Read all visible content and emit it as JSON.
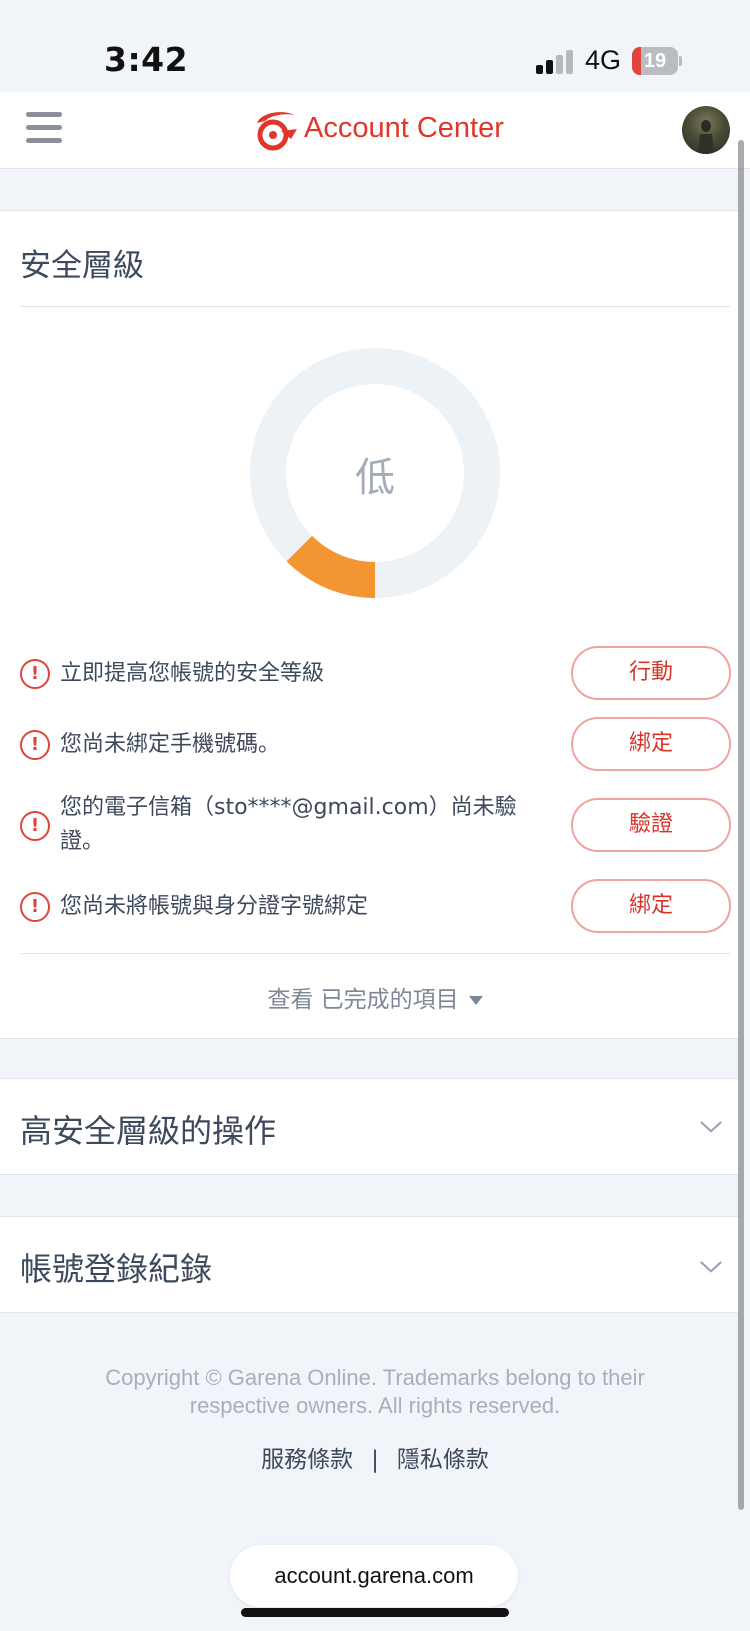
{
  "status_bar": {
    "time": "3:42",
    "network": "4G",
    "battery": "19",
    "battery_level": 0.19
  },
  "header": {
    "title": "Account Center",
    "menu_icon": "hamburger-menu-icon",
    "logo_icon": "garena-logo-icon",
    "avatar": "user-avatar"
  },
  "security": {
    "title": "安全層級",
    "level": "低",
    "level_fraction": 0.125,
    "colors": {
      "ring_bg": "#edf2f6",
      "progress": "#f39631",
      "alert": "#e0443a"
    },
    "tasks": [
      {
        "text": "立即提高您帳號的安全等級",
        "action": "行動"
      },
      {
        "text": "您尚未綁定手機號碼。",
        "action": "綁定"
      },
      {
        "text": "您的電子信箱（sto****@gmail.com）尚未驗證。",
        "action": "驗證"
      },
      {
        "text": "您尚未將帳號與身分證字號綁定",
        "action": "綁定"
      }
    ],
    "view_completed": "查看 已完成的項目"
  },
  "accordions": [
    {
      "title": "高安全層級的操作"
    },
    {
      "title": "帳號登錄紀錄"
    }
  ],
  "footer": {
    "copyright": "Copyright © Garena Online. Trademarks belong to their respective owners. All rights reserved.",
    "links": [
      "服務條款",
      "隱私條款"
    ],
    "separator": "|"
  },
  "browser": {
    "url": "account.garena.com"
  }
}
